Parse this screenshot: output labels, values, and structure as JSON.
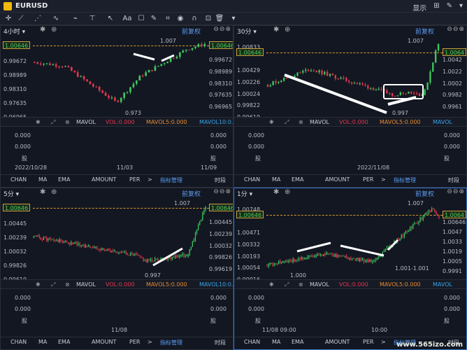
{
  "titlebar": {
    "symbol": "EURUSD",
    "display": "显示",
    "menu_arrow": "▾"
  },
  "toolbar": {
    "tools": [
      "cursor-tool",
      "line-tool",
      "trend-tool",
      "pencil-tool",
      "text-tool",
      "arrow-tool",
      "label-tool",
      "measure-tool",
      "brush-tool",
      "eraser-tool",
      "eye-tool",
      "magnet-tool",
      "lock-tool",
      "trash-tool",
      "more-tool"
    ]
  },
  "icons": {
    "gear": "✱",
    "plus": "⊕",
    "ctrls": "⊖⊖⊗"
  },
  "panels": [
    {
      "timeframe": "4小时 ▾",
      "fq": "前复权",
      "prices": [
        "1.00646",
        "0.99672",
        "0.98989",
        "0.98310",
        "0.97635",
        "0.96965"
      ],
      "right_prices": [
        "1.00646",
        "0.99672",
        "0.98989",
        "0.98310",
        "0.97635",
        "0.96965"
      ],
      "tag_left": "1.00646",
      "tag_right": "1.00646",
      "high_label": "1.007",
      "low_label": "0.973",
      "ind": {
        "vol": "VOL:0.000",
        "mavol5": "MAVOL5:0.000",
        "mavol10": "MAVOL10:0.0",
        "name": "MAVOL"
      },
      "ind_vals": [
        "0.000",
        "0.000"
      ],
      "unit": "股",
      "dates": [
        "2022/10/28",
        "11/03",
        "11/09"
      ],
      "tabs": [
        "CHAN",
        "MA",
        "EMA",
        "AMOUNT",
        "PER",
        ">",
        "指标管理",
        "时段"
      ]
    },
    {
      "timeframe": "30分 ▾",
      "fq": "前复权",
      "prices": [
        "1.00833",
        "1.00646",
        "1.00429",
        "1.00226",
        "1.00024",
        "0.99822",
        "0.99619"
      ],
      "right_prices": [
        "1.00646",
        "1.0042",
        "1.0022",
        "1.0002",
        "0.9982",
        "0.9961"
      ],
      "tag_left": "1.00646",
      "tag_right": "1.0064",
      "high_label": "1.007",
      "low_label": "0.997",
      "ind": {
        "vol": "VOL:0.000",
        "mavol5": "MAVOL5:0.000",
        "mavol10": "MAVOL",
        "name": "MAVOL"
      },
      "ind_vals": [
        "0.000",
        "0.000"
      ],
      "unit": "股",
      "dates": [
        "2022/11/08"
      ],
      "tabs": [
        "CHAN",
        "MA",
        "EMA",
        "AMOUNT",
        "PER",
        ">",
        "指标管理",
        "时段"
      ]
    },
    {
      "timeframe": "5分 ▾",
      "fq": "前复权",
      "prices": [
        "1.00646",
        "1.00445",
        "1.00239",
        "1.00032",
        "0.99826",
        "0.99619"
      ],
      "right_prices": [
        "1.00646",
        "1.00445",
        "1.00239",
        "1.00032",
        "0.99826",
        "0.99619"
      ],
      "tag_left": "1.00646",
      "tag_right": "1.00646",
      "high_label": "1.007",
      "low_label": "0.997",
      "ind": {
        "vol": "VOL:0.000",
        "mavol5": "MAVOL5:0.000",
        "mavol10": "MAVOL10:0.000",
        "name": "MAVOL"
      },
      "ind_vals": [
        "0.000",
        "0.000"
      ],
      "unit": "股",
      "dates": [
        "11/08"
      ],
      "tabs": [
        "CHAN",
        "MA",
        "EMA",
        "AMOUNT",
        "PER",
        ">",
        "指标管理",
        "时段"
      ]
    },
    {
      "timeframe": "1分 ▾",
      "fq": "前复权",
      "prices": [
        "1.00748",
        "1.00646",
        "1.00471",
        "1.00332",
        "1.00193",
        "1.00054",
        "0.99916"
      ],
      "right_prices": [
        "1.0074",
        "1.00646",
        "1.0047",
        "1.0033",
        "1.0019",
        "1.0005",
        "0.9991"
      ],
      "tag_left": "1.00646",
      "tag_right": "1.0064",
      "high_label": "1.007",
      "low_label": "1.000",
      "range_label": "1.001-1.001",
      "ind": {
        "vol": "VOL:0.000",
        "mavol5": "MAVOL5:0.000",
        "mavol10": "MAVOL",
        "name": "MAVOL"
      },
      "ind_vals": [
        "0.000",
        "0.000"
      ],
      "unit": "股",
      "dates": [
        "11/08 09:00",
        "10:00"
      ],
      "tabs": [
        "CHAN",
        "MA",
        "EMA",
        "AMOUNT",
        "PER",
        ">",
        "指标管理",
        "时段"
      ]
    }
  ],
  "watermark": "www.565izo.com",
  "colors": {
    "up": "#3ec95e",
    "down": "#e0384e",
    "accent": "#5b9cf0",
    "dashed": "#d79a2b"
  }
}
